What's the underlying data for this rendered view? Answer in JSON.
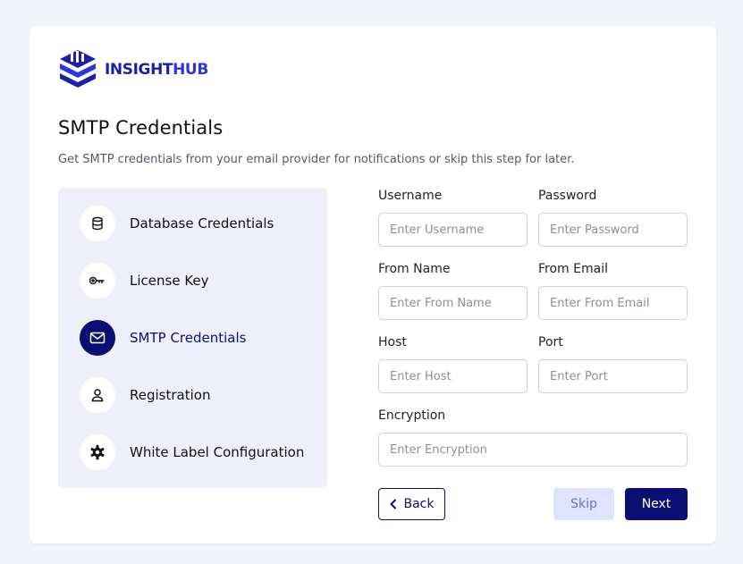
{
  "brand": {
    "name_part1": "INSIGHT",
    "name_part2": "HUB"
  },
  "page": {
    "title": "SMTP Credentials",
    "subtitle": "Get SMTP credentials from your email provider for notifications or skip this step for later."
  },
  "steps": [
    {
      "label": "Database Credentials",
      "icon": "database-icon",
      "active": false
    },
    {
      "label": "License Key",
      "icon": "key-icon",
      "active": false
    },
    {
      "label": "SMTP Credentials",
      "icon": "mail-icon",
      "active": true
    },
    {
      "label": "Registration",
      "icon": "user-icon",
      "active": false
    },
    {
      "label": "White Label Configuration",
      "icon": "gear-icon",
      "active": false
    }
  ],
  "form": {
    "username": {
      "label": "Username",
      "placeholder": "Enter Username",
      "value": ""
    },
    "password": {
      "label": "Password",
      "placeholder": "Enter Password",
      "value": ""
    },
    "from_name": {
      "label": "From Name",
      "placeholder": "Enter From Name",
      "value": ""
    },
    "from_email": {
      "label": "From Email",
      "placeholder": "Enter From Email",
      "value": ""
    },
    "host": {
      "label": "Host",
      "placeholder": "Enter Host",
      "value": ""
    },
    "port": {
      "label": "Port",
      "placeholder": "Enter Port",
      "value": ""
    },
    "encryption": {
      "label": "Encryption",
      "placeholder": "Enter Encryption",
      "value": ""
    }
  },
  "buttons": {
    "back": "Back",
    "skip": "Skip",
    "next": "Next"
  },
  "colors": {
    "primary": "#0a0f73",
    "brand": "#1c1fa8",
    "brand_accent": "#2b35e0",
    "steps_bg": "#eeeffb",
    "skip_bg": "#dfe3fb",
    "page_bg": "#f1f4fb"
  }
}
